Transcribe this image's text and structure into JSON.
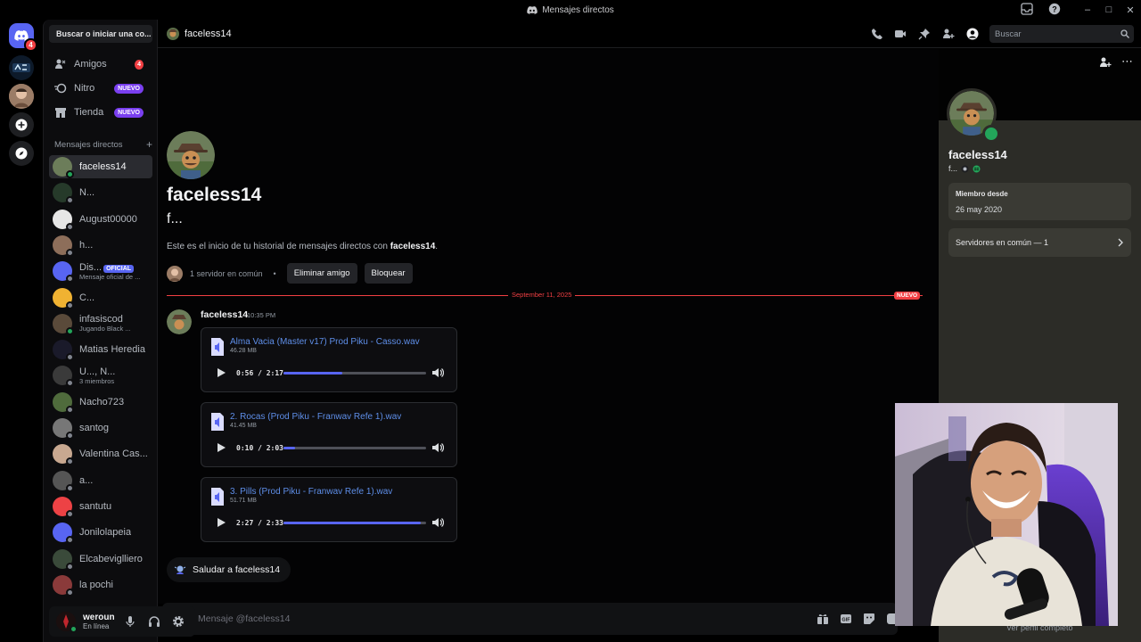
{
  "window": {
    "title": "Mensajes directos"
  },
  "sidebar": {
    "search": "Buscar o iniciar una co...",
    "nav": [
      {
        "label": "Amigos",
        "badge": "4"
      },
      {
        "label": "Nitro",
        "badge": "NUEVO"
      },
      {
        "label": "Tienda",
        "badge": "NUEVO"
      }
    ],
    "dm_header": "Mensajes directos",
    "dm_add": "+",
    "dms": [
      {
        "name": "faceless14",
        "sub": ""
      },
      {
        "name": "N...",
        "sub": ""
      },
      {
        "name": "August00000",
        "sub": ""
      },
      {
        "name": "h...",
        "sub": ""
      },
      {
        "name": "Dis...",
        "badge": "OFICIAL",
        "sub": "Mensaje oficial de ..."
      },
      {
        "name": "C...",
        "sub": ""
      },
      {
        "name": "infasiscod",
        "sub": "Jugando Black ..."
      },
      {
        "name": "Matias Heredia",
        "sub": ""
      },
      {
        "name": "U..., N...",
        "sub": "3 miembros"
      },
      {
        "name": "Nacho723",
        "sub": ""
      },
      {
        "name": "santog",
        "sub": ""
      },
      {
        "name": "Valentina Cas...",
        "sub": ""
      },
      {
        "name": "a...",
        "sub": ""
      },
      {
        "name": "santutu",
        "sub": ""
      },
      {
        "name": "Jonilolapeia",
        "sub": ""
      },
      {
        "name": "Elcabeviglliero",
        "sub": ""
      },
      {
        "name": "la pochi",
        "sub": ""
      }
    ],
    "user": {
      "name": "weroun",
      "status": "En línea"
    },
    "rail_badge": "4"
  },
  "header": {
    "name": "faceless14",
    "search_placeholder": "Buscar"
  },
  "chat": {
    "title": "faceless14",
    "subtitle": "f...",
    "intro_prefix": "Este es el inicio de tu historial de mensajes directos con ",
    "intro_name": "faceless14",
    "intro_suffix": ".",
    "mutual": "1 servidor en común",
    "mutual_sep": "•",
    "remove_friend": "Eliminar amigo",
    "block": "Bloquear",
    "divider_date": "September 11, 2025",
    "divider_new": "NUEVO",
    "message": {
      "author": "faceless14",
      "time": "10:35 PM",
      "attachments": [
        {
          "name": "Alma Vacia (Master v17) Prod Piku - Casso.wav",
          "size": "46.28 MB",
          "time": "0:56 / 2:17",
          "progress": 0.41
        },
        {
          "name": "2. Rocas (Prod Piku - Franwav Refe 1).wav",
          "size": "41.45 MB",
          "time": "0:10 / 2:03",
          "progress": 0.08
        },
        {
          "name": "3. Pills (Prod Piku - Franwav Refe 1).wav",
          "size": "51.71 MB",
          "time": "2:27 / 2:33",
          "progress": 0.96
        }
      ]
    },
    "wave": "Saludar a faceless14"
  },
  "composer": {
    "placeholder": "Mensaje @faceless14"
  },
  "profile": {
    "name": "faceless14",
    "tag": "f...",
    "member_since_label": "Miembro desde",
    "member_since": "26 may 2020",
    "mutual_servers": "Servidores en común — 1",
    "view_full": "Ver perfil completo"
  },
  "colors": {
    "accent": "#5865f2",
    "online": "#23a55a",
    "danger": "#f23f43",
    "link": "#5e8ee8"
  }
}
